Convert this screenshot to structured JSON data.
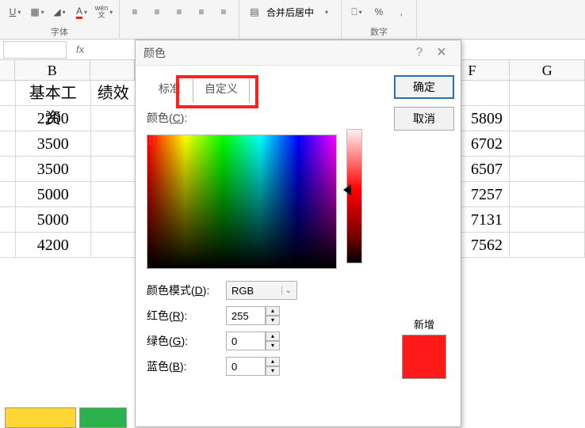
{
  "ribbon": {
    "font_group_label": "字体",
    "number_group_label": "数字",
    "underline": "U",
    "wenzi": "wén",
    "wenzi_sub": "文",
    "merge_label": "合并后居中",
    "percent": "%",
    "comma": ","
  },
  "columns": {
    "B": "B",
    "F": "F",
    "G": "G"
  },
  "headers": {
    "B": "基本工资",
    "C": "绩效"
  },
  "data_B": [
    "2200",
    "3500",
    "3500",
    "5000",
    "5000",
    "4200"
  ],
  "data_F": [
    "5809",
    "6702",
    "6507",
    "7257",
    "7131",
    "7562"
  ],
  "dialog": {
    "title": "颜色",
    "tab_standard": "标准",
    "tab_custom": "自定义",
    "ok": "确定",
    "cancel": "取消",
    "color_label_pre": "颜色(",
    "color_label_u": "C",
    "color_label_post": "):",
    "mode_label_pre": "颜色模式(",
    "mode_label_u": "D",
    "mode_label_post": "):",
    "mode_value": "RGB",
    "red_pre": "红色(",
    "red_u": "R",
    "red_post": "):",
    "red_val": "255",
    "green_pre": "绿色(",
    "green_u": "G",
    "green_post": "):",
    "green_val": "0",
    "blue_pre": "蓝色(",
    "blue_u": "B",
    "blue_post": "):",
    "blue_val": "0",
    "new_label": "新增"
  }
}
